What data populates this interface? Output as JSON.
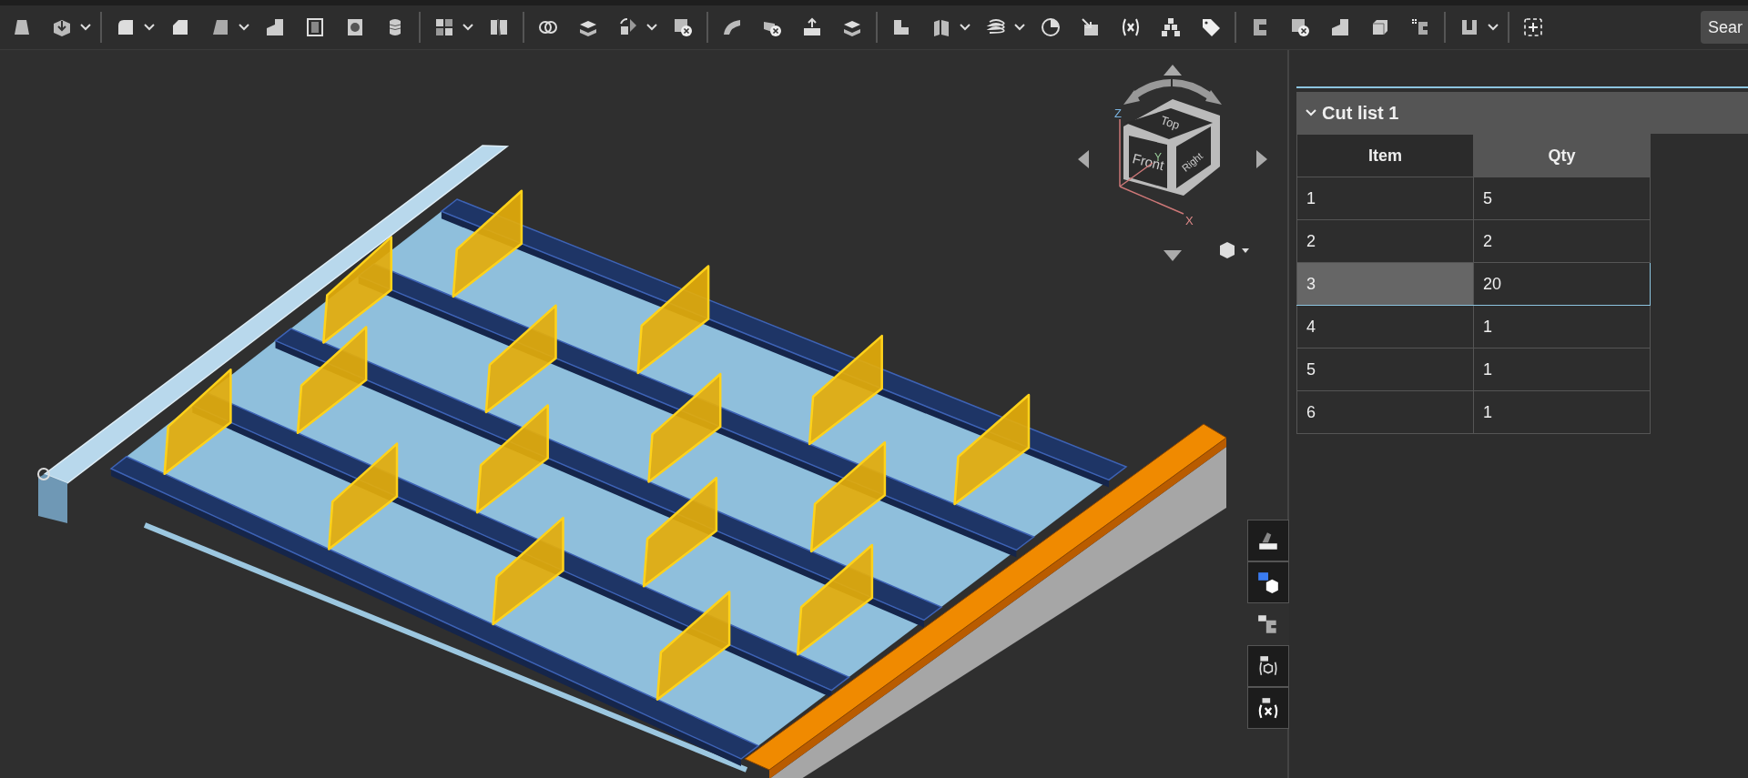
{
  "toolbar": {
    "search": {
      "placeholder": "Sear"
    }
  },
  "view_cube": {
    "faces": [
      "Top",
      "Front",
      "Right"
    ],
    "axes": [
      "Z",
      "Y",
      "X"
    ]
  },
  "panel": {
    "cut_list": {
      "title": "Cut list 1",
      "expanded": true,
      "columns": [
        {
          "label": "Item",
          "selected": false
        },
        {
          "label": "Qty",
          "selected": true
        }
      ],
      "rows": [
        {
          "cells": [
            "1",
            "5"
          ],
          "selected": false
        },
        {
          "cells": [
            "2",
            "2"
          ],
          "selected": false
        },
        {
          "cells": [
            "3",
            "20"
          ],
          "selected": true
        },
        {
          "cells": [
            "4",
            "1"
          ],
          "selected": false
        },
        {
          "cells": [
            "5",
            "1"
          ],
          "selected": false
        },
        {
          "cells": [
            "6",
            "1"
          ],
          "selected": false
        }
      ]
    }
  }
}
